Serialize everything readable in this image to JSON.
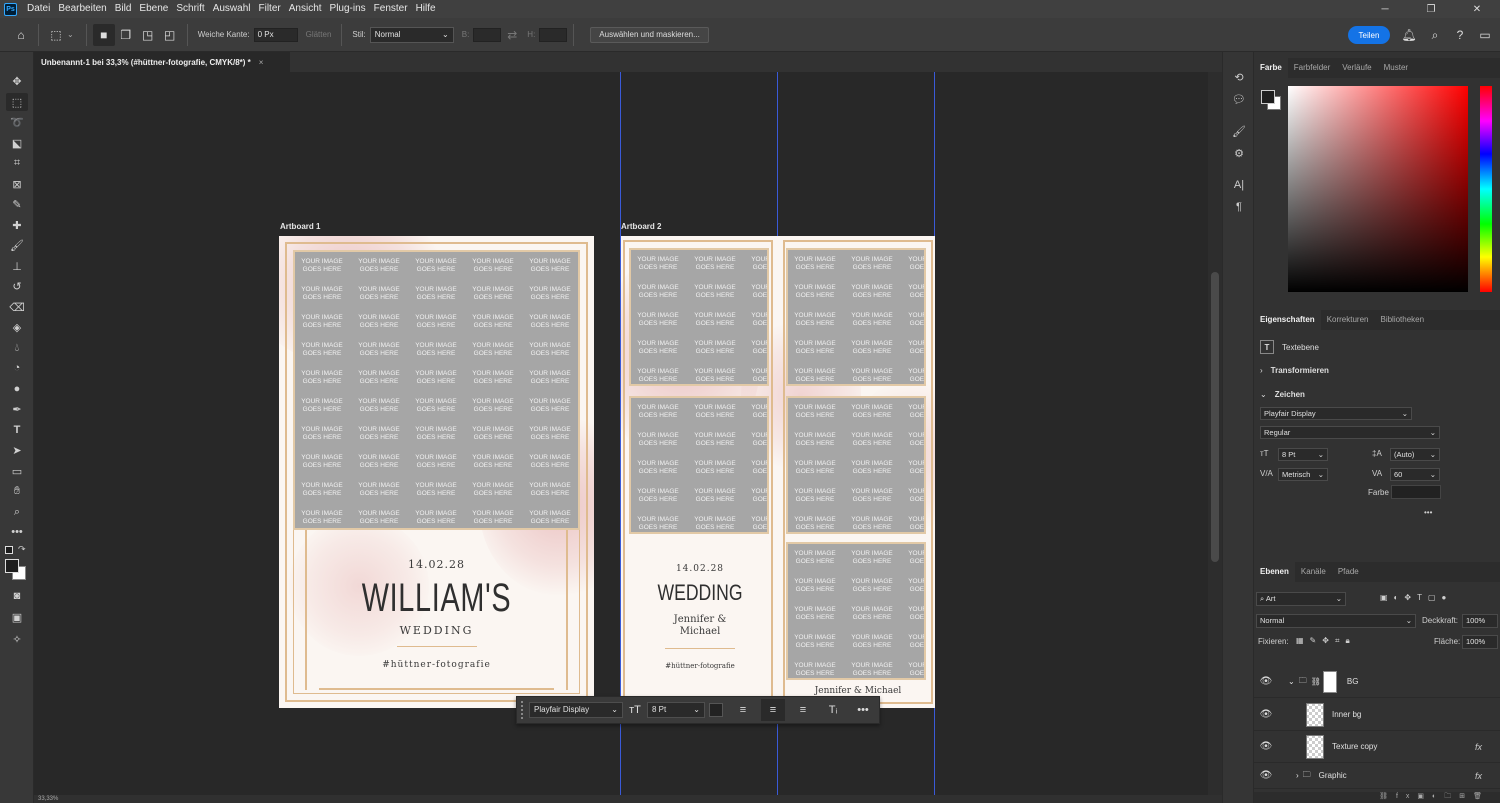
{
  "app": {
    "logo": "Ps",
    "menu": [
      "Datei",
      "Bearbeiten",
      "Bild",
      "Ebene",
      "Schrift",
      "Auswahl",
      "Filter",
      "Ansicht",
      "Plug-ins",
      "Fenster",
      "Hilfe"
    ],
    "window_controls": [
      "─",
      "❐",
      "✕"
    ]
  },
  "options": {
    "feather_label": "Weiche Kante:",
    "feather_value": "0 Px",
    "smooth_label": "Glätten",
    "style_label": "Stil:",
    "style_value": "Normal",
    "width_label": "B:",
    "height_label": "H:",
    "mask_button": "Auswählen und maskieren...",
    "share_button": "Teilen"
  },
  "document": {
    "tab_title": "Unbenannt-1 bei 33,3% (#hüttner-fotografie, CMYK/8*) *",
    "tab_close": "×"
  },
  "artboards": {
    "a1_label": "Artboard 1",
    "a2_label": "Artboard 2",
    "placeholder_line1": "YOUR IMAGE",
    "placeholder_line2": "GOES HERE",
    "a1_date": "14.02.28",
    "a1_title": "WILLIAM'S",
    "a1_sub": "WEDDING",
    "a1_hashtag": "#hüttner-fotografie",
    "a2_date": "14.02.28",
    "a2_title": "WEDDING",
    "a2_names": "Jennifer &\nMichael",
    "a2_hashtag": "#hüttner-fotografie",
    "a2_footer": "Jennifer & Michael"
  },
  "text_toolbar": {
    "font": "Playfair Display",
    "size": "8 Pt"
  },
  "color_panel": {
    "tabs": [
      "Farbe",
      "Farbfelder",
      "Verläufe",
      "Muster"
    ]
  },
  "properties_panel": {
    "tabs": [
      "Eigenschaften",
      "Korrekturen",
      "Bibliotheken"
    ],
    "layer_type": "Textebene",
    "transform": "Transformieren",
    "character": "Zeichen",
    "font_family": "Playfair Display",
    "font_style": "Regular",
    "font_size": "8 Pt",
    "leading": "(Auto)",
    "kerning": "Metrisch",
    "tracking": "60",
    "color_label": "Farbe",
    "more": "•••"
  },
  "layers_panel": {
    "tabs": [
      "Ebenen",
      "Kanäle",
      "Pfade"
    ],
    "filter_value": "Art",
    "blend_mode": "Normal",
    "opacity_label": "Deckkraft:",
    "opacity_value": "100%",
    "lock_label": "Fixieren:",
    "fill_label": "Fläche:",
    "fill_value": "100%",
    "layers": [
      {
        "name": "BG",
        "type": "group"
      },
      {
        "name": "Inner bg",
        "type": "layer"
      },
      {
        "name": "Texture copy",
        "type": "layer",
        "fx": "fx"
      },
      {
        "name": "Graphic",
        "type": "group",
        "fx": "fx"
      }
    ]
  },
  "status": {
    "text": "33,33%"
  },
  "colors": {
    "accent": "#1473e6",
    "gold": "#dfbb8f",
    "guide": "#3a5ad8"
  }
}
